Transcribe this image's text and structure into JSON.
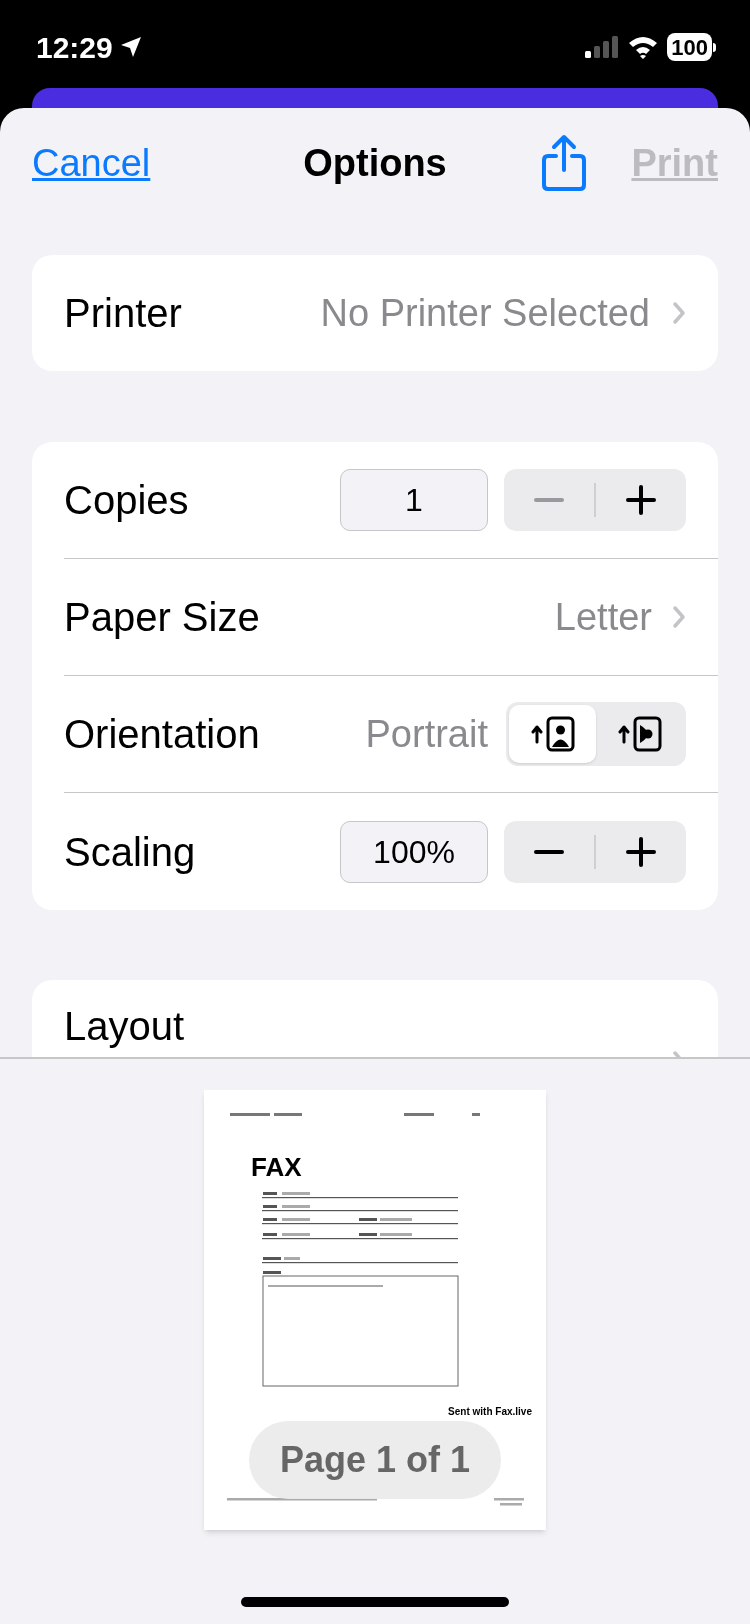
{
  "status_bar": {
    "time": "12:29",
    "battery": "100"
  },
  "nav": {
    "cancel": "Cancel",
    "title": "Options",
    "print": "Print",
    "print_disabled": true
  },
  "printer": {
    "label": "Printer",
    "value": "No Printer Selected"
  },
  "settings": [
    {
      "kind": "stepper",
      "label": "Copies",
      "value": "1",
      "minus_disabled": true
    },
    {
      "kind": "picker",
      "label": "Paper Size",
      "value": "Letter"
    },
    {
      "kind": "orientation",
      "label": "Orientation",
      "value": "Portrait",
      "options": [
        {
          "selected": true
        },
        {
          "selected": false
        }
      ]
    },
    {
      "kind": "stepper",
      "label": "Scaling",
      "value": "100%",
      "minus_disabled": false
    }
  ],
  "layout": {
    "label": "Layout"
  },
  "preview": {
    "title": "FAX",
    "footer": "Sent with Fax.live",
    "page_indicator": "Page 1 of 1"
  }
}
